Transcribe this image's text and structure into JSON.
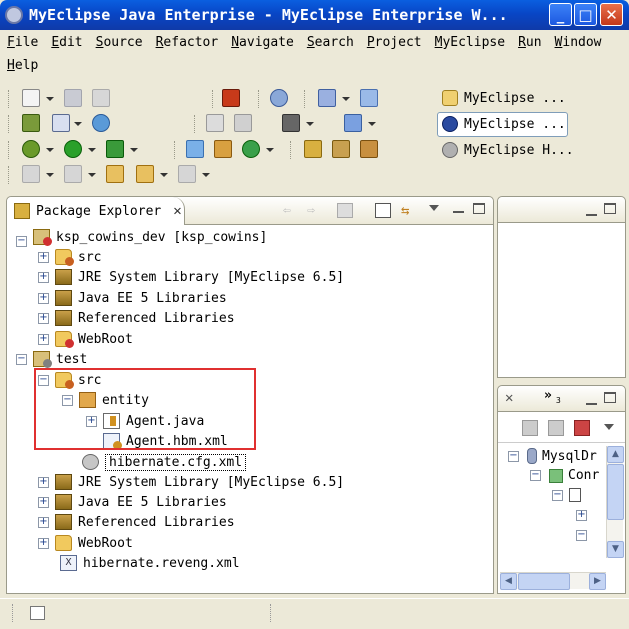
{
  "window": {
    "title": "MyEclipse Java Enterprise - MyEclipse Enterprise W...",
    "buttons": {
      "minimize": "_",
      "maximize": "□",
      "close": "✕"
    }
  },
  "menu": [
    "File",
    "Edit",
    "Source",
    "Refactor",
    "Navigate",
    "Search",
    "Project",
    "MyEclipse",
    "Run",
    "Window",
    "Help"
  ],
  "perspectives": [
    {
      "label": "MyEclipse ...",
      "selected": false
    },
    {
      "label": "MyEclipse ...",
      "selected": true
    },
    {
      "label": "MyEclipse H...",
      "selected": false
    }
  ],
  "package_explorer": {
    "tab_label": "Package Explorer",
    "tree": [
      {
        "label": "ksp_cowins_dev [ksp_cowins]",
        "icon": "project-icon",
        "expander": "−",
        "level": 0
      },
      {
        "label": "src",
        "icon": "source-folder-icon",
        "expander": "+",
        "level": 1
      },
      {
        "label": "JRE System Library [MyEclipse 6.5]",
        "icon": "library-icon",
        "expander": "+",
        "level": 1
      },
      {
        "label": "Java EE 5 Libraries",
        "icon": "library-icon",
        "expander": "+",
        "level": 1
      },
      {
        "label": "Referenced Libraries",
        "icon": "library-icon",
        "expander": "+",
        "level": 1
      },
      {
        "label": "WebRoot",
        "icon": "webroot-folder-icon",
        "expander": "+",
        "level": 1
      },
      {
        "label": "test",
        "icon": "project-icon",
        "expander": "−",
        "level": 0
      },
      {
        "label": "src",
        "icon": "source-folder-icon",
        "expander": "−",
        "level": 1
      },
      {
        "label": "entity",
        "icon": "package-icon",
        "expander": "−",
        "level": 2
      },
      {
        "label": "Agent.java",
        "icon": "java-file-icon",
        "expander": "+",
        "level": 3
      },
      {
        "label": "Agent.hbm.xml",
        "icon": "hbm-xml-file-icon",
        "expander": "",
        "level": 3
      },
      {
        "label": "hibernate.cfg.xml",
        "icon": "config-file-icon",
        "expander": "",
        "level": 2,
        "selected": true
      },
      {
        "label": "JRE System Library [MyEclipse 6.5]",
        "icon": "library-icon",
        "expander": "+",
        "level": 1
      },
      {
        "label": "Java EE 5 Libraries",
        "icon": "library-icon",
        "expander": "+",
        "level": 1
      },
      {
        "label": "Referenced Libraries",
        "icon": "library-icon",
        "expander": "+",
        "level": 1
      },
      {
        "label": "WebRoot",
        "icon": "folder-icon",
        "expander": "+",
        "level": 1
      },
      {
        "label": "hibernate.reveng.xml",
        "icon": "xml-file-icon",
        "expander": "",
        "level": 1
      }
    ]
  },
  "db_browser": {
    "tab_overflow": "»",
    "tab_overflow_count": "3",
    "items": [
      "MysqlDr",
      "Conr"
    ]
  }
}
